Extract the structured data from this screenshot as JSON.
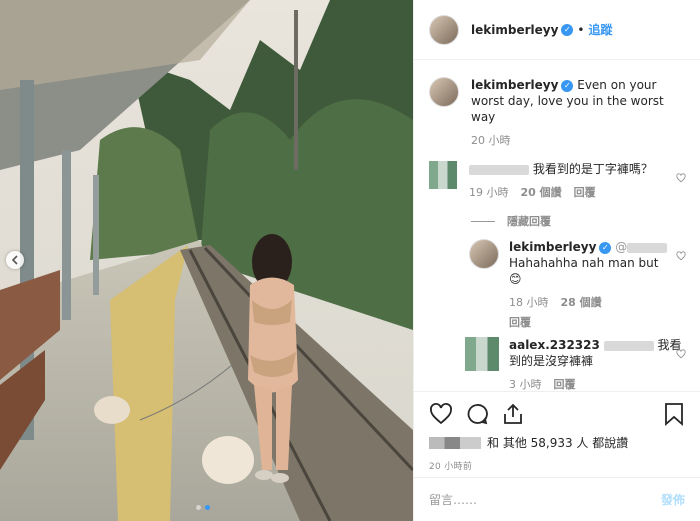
{
  "post": {
    "username": "lekimberleyy",
    "follow_label": "追蹤",
    "caption": "Even on your worst day, love you in the worst way",
    "caption_time": "20 小時",
    "likes_suffix": "和 其他 58,933 人 都說讚",
    "time_ago": "20 小時前",
    "comment_placeholder": "留言……",
    "post_label": "發佈"
  },
  "comments": [
    {
      "text": "我看到的是丁字褲嗎？",
      "time": "19 小時",
      "likes": "20 個讚",
      "reply": "回覆"
    },
    {
      "hide_replies": "隱藏回覆"
    },
    {
      "username": "lekimberleyy",
      "mention": "@",
      "text": "Hahahahha nah man but",
      "emoji": "😊",
      "time": "18 小時",
      "likes": "28 個讚",
      "reply": "回覆"
    },
    {
      "username": "aalex.232323",
      "text": "我看到的是沒穿褲褲",
      "time": "3 小時",
      "reply": "回覆"
    }
  ],
  "colors": {
    "accent": "#3897f0",
    "muted": "#8e8e8e"
  }
}
